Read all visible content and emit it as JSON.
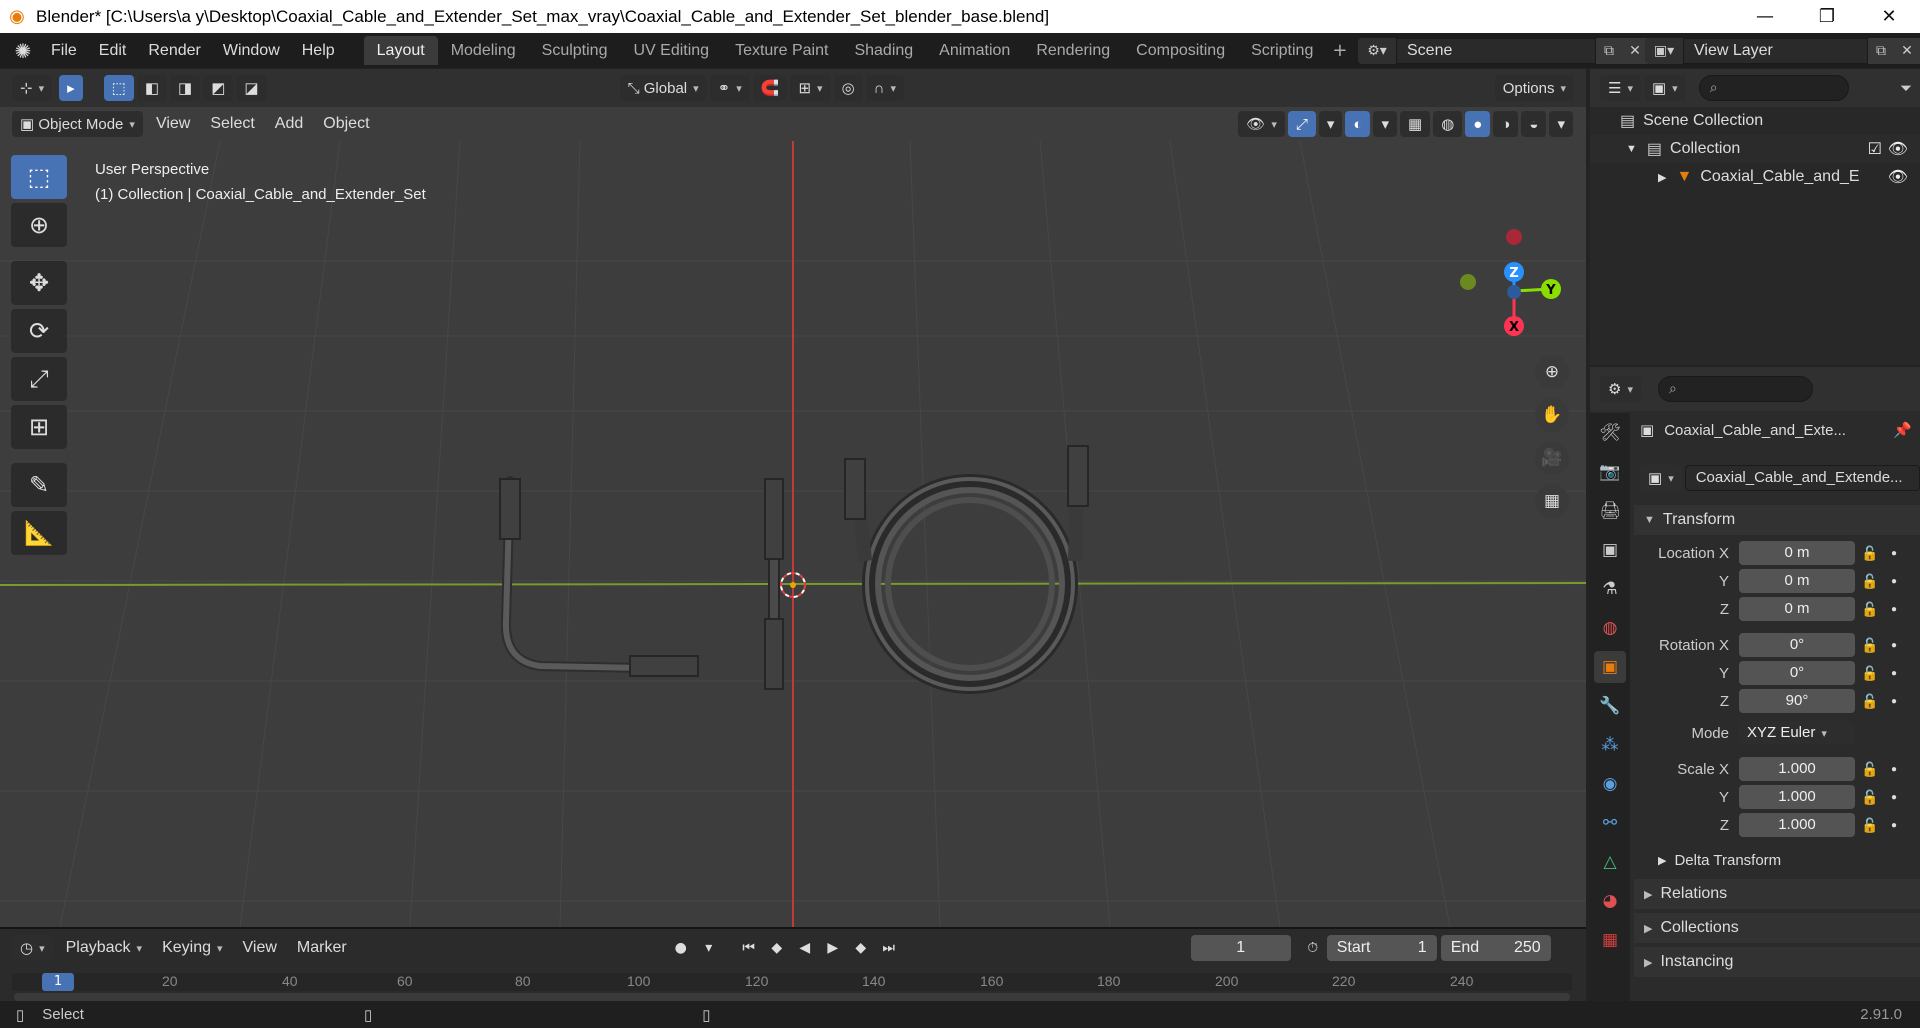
{
  "window": {
    "title": "Blender* [C:\\Users\\a y\\Desktop\\Coaxial_Cable_and_Extender_Set_max_vray\\Coaxial_Cable_and_Extender_Set_blender_base.blend]",
    "minimize": "—",
    "maximize": "❐",
    "close": "✕"
  },
  "menu": [
    "File",
    "Edit",
    "Render",
    "Window",
    "Help"
  ],
  "workspaces": [
    "Layout",
    "Modeling",
    "Sculpting",
    "UV Editing",
    "Texture Paint",
    "Shading",
    "Animation",
    "Rendering",
    "Compositing",
    "Scripting"
  ],
  "workspace_add": "+",
  "scene": {
    "value": "Scene"
  },
  "view_layer": {
    "value": "View Layer"
  },
  "viewport": {
    "mode": "Object Mode",
    "menus": [
      "View",
      "Select",
      "Add",
      "Object"
    ],
    "transform_orientation": "Global",
    "options_label": "Options",
    "info_line1": "User Perspective",
    "info_line2": "(1) Collection | Coaxial_Cable_and_Extender_Set",
    "gizmo": {
      "z": "Z",
      "y": "Y",
      "x": "X"
    }
  },
  "timeline": {
    "menus": [
      "Playback",
      "Keying",
      "View",
      "Marker"
    ],
    "current_frame": "1",
    "start_label": "Start",
    "start": "1",
    "end_label": "End",
    "end": "250",
    "ruler": [
      "1",
      "20",
      "40",
      "60",
      "80",
      "100",
      "120",
      "140",
      "160",
      "180",
      "200",
      "220",
      "240"
    ]
  },
  "status": {
    "left": "Select",
    "version": "2.91.0"
  },
  "outliner": {
    "rows": [
      {
        "label": "Scene Collection"
      },
      {
        "label": "Collection"
      },
      {
        "label": "Coaxial_Cable_and_E"
      }
    ]
  },
  "properties": {
    "object_name": "Coaxial_Cable_and_Exte...",
    "object_data_name": "Coaxial_Cable_and_Extende...",
    "transform_title": "Transform",
    "location": {
      "label_x": "Location X",
      "label_y": "Y",
      "label_z": "Z",
      "x": "0 m",
      "y": "0 m",
      "z": "0 m"
    },
    "rotation": {
      "label_x": "Rotation X",
      "label_y": "Y",
      "label_z": "Z",
      "x": "0°",
      "y": "0°",
      "z": "90°"
    },
    "mode_label": "Mode",
    "mode_value": "XYZ Euler",
    "scale": {
      "label_x": "Scale X",
      "label_y": "Y",
      "label_z": "Z",
      "x": "1.000",
      "y": "1.000",
      "z": "1.000"
    },
    "delta_transform": "Delta Transform",
    "panels": [
      "Relations",
      "Collections",
      "Instancing"
    ]
  },
  "colors": {
    "accent": "#4772b3",
    "x_axis": "#ff3352",
    "y_axis": "#8bdc00",
    "z_axis": "#2890ff",
    "object_orange": "#e87d0d"
  }
}
